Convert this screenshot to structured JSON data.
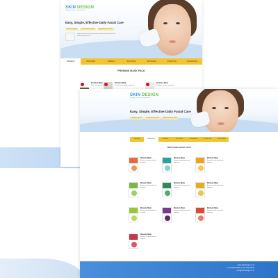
{
  "brand": {
    "logo_main": "SKIN",
    "logo_accent": "DESIGN",
    "tagline": "Simply | Skin Caring Brand"
  },
  "headline": "Easy, Simple, Effective Daily Facial Care",
  "hero_pills": [
    "Good for dry skin",
    "Low-irritation formula",
    "High-adherence sheet"
  ],
  "hero_desc": "Daily-use facial mask sheets enriched with natural extracts for hydrated, glowing skin",
  "nav": [
    "PREMIUM",
    "MOISTURE",
    "FIRMING",
    "SOOTHING",
    "WHITENING",
    "PURIFYING",
    "NOURISHING"
  ],
  "page1": {
    "section_title": "PREMIUM MASK PACK",
    "products": [
      {
        "name": "Premium Mask",
        "desc": "Premium essence facial mask pack",
        "color": "#7a5a3c"
      },
      {
        "name": "Premium Mask",
        "desc": "Pearl essence brightening mask",
        "color": "#d9d5cf"
      },
      {
        "name": "Premium Mask",
        "desc": "Collagen essence mask pack",
        "color": "#f0ece6"
      },
      {
        "name": "Premium Mask",
        "desc": "Hyaluronic hydrating mask",
        "color": "#4d8fd6"
      }
    ]
  },
  "page2": {
    "section_title": "MOISTURE MASK PACK",
    "cards": [
      {
        "name": "Moisture Mask",
        "desc": "Essence facial mask pack, moisture",
        "band": "#e36a3a",
        "img": "#e89a5a"
      },
      {
        "name": "Moisture Mask",
        "desc": "Essence facial mask pack, moisture",
        "band": "#2aa3a0",
        "img": "#8fd0c8"
      },
      {
        "name": "Moisture Mask",
        "desc": "Essence facial mask pack, moisture",
        "band": "#f0a020",
        "img": "#f3c860"
      },
      {
        "name": "Moisture Mask",
        "desc": "Essence facial mask pack, moisture",
        "band": "#7bb842",
        "img": "#9ccf6a"
      },
      {
        "name": "Moisture Mask",
        "desc": "Essence facial mask pack, moisture",
        "band": "#2e8b57",
        "img": "#5aa66e"
      },
      {
        "name": "Moisture Mask",
        "desc": "Essence facial mask pack, moisture",
        "band": "#e0b020",
        "img": "#e8c84a"
      },
      {
        "name": "Moisture Mask",
        "desc": "Essence facial mask pack, moisture",
        "band": "#9bc43a",
        "img": "#b8d86a"
      },
      {
        "name": "Moisture Mask",
        "desc": "Essence facial mask pack, moisture",
        "band": "#7a3b8c",
        "img": "#5a2d6a"
      },
      {
        "name": "Moisture Mask",
        "desc": "Essence facial mask pack, moisture",
        "band": "#d94a3a",
        "img": "#e87a6a"
      },
      {
        "name": "Moisture Mask",
        "desc": "Essence facial mask pack, moisture",
        "band": "#c0384a",
        "img": "#d05a6a"
      }
    ]
  },
  "footer": {
    "line1": "www.skindesign.co.kr",
    "line2": "T. 02-1234-5678 | F. 02-1234-5679",
    "line3": "info@skindesign.co.kr"
  },
  "colors": {
    "nav": "#f2c42f",
    "footer": "#2d74c9",
    "brand_blue": "#2f9bd6",
    "brand_green": "#6cc24a"
  }
}
